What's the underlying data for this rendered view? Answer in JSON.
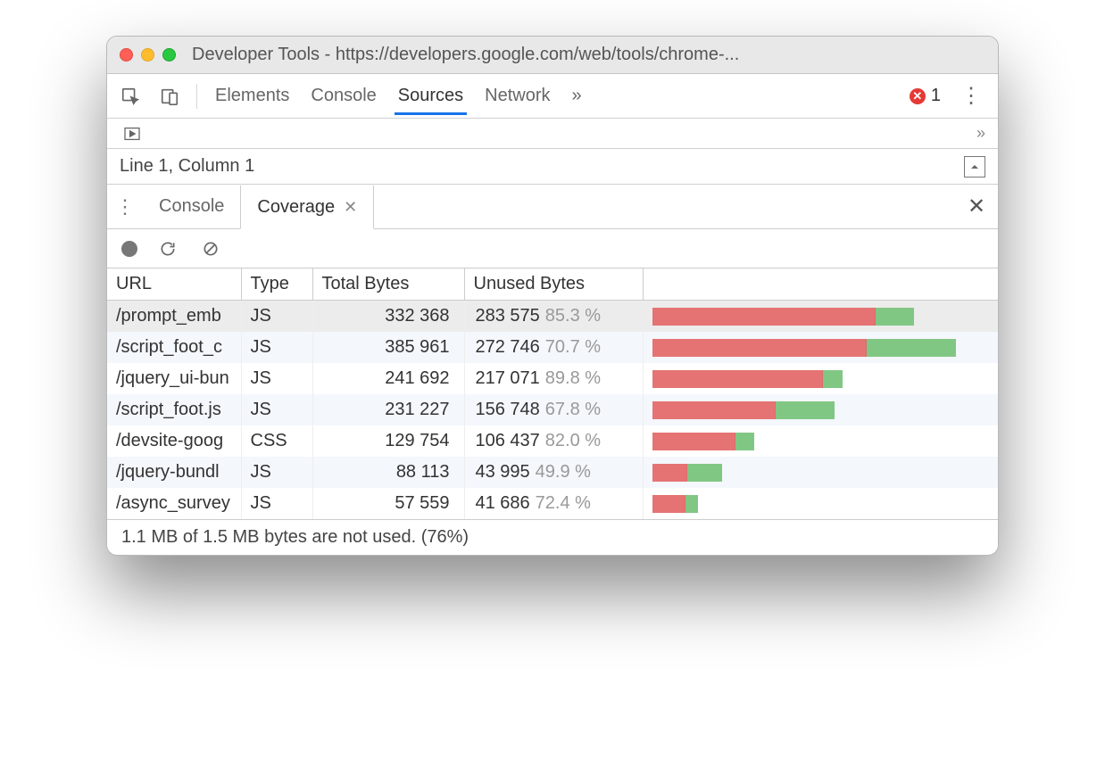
{
  "window": {
    "title": "Developer Tools - https://developers.google.com/web/tools/chrome-..."
  },
  "toolbar": {
    "tabs": [
      "Elements",
      "Console",
      "Sources",
      "Network"
    ],
    "active_tab": "Sources",
    "overflow_glyph": "»",
    "error_count": "1"
  },
  "status": {
    "cursor_position": "Line 1, Column 1"
  },
  "drawer": {
    "tabs": [
      "Console",
      "Coverage"
    ],
    "active": "Coverage"
  },
  "coverage": {
    "headers": {
      "url": "URL",
      "type": "Type",
      "total": "Total Bytes",
      "unused": "Unused Bytes"
    },
    "max_total": 385961,
    "rows": [
      {
        "url": "/prompt_emb",
        "type": "JS",
        "total": "332 368",
        "unused": "283 575",
        "pct": "85.3 %",
        "total_n": 332368,
        "unused_pct": 85.3,
        "selected": true
      },
      {
        "url": "/script_foot_c",
        "type": "JS",
        "total": "385 961",
        "unused": "272 746",
        "pct": "70.7 %",
        "total_n": 385961,
        "unused_pct": 70.7
      },
      {
        "url": "/jquery_ui-bun",
        "type": "JS",
        "total": "241 692",
        "unused": "217 071",
        "pct": "89.8 %",
        "total_n": 241692,
        "unused_pct": 89.8
      },
      {
        "url": "/script_foot.js",
        "type": "JS",
        "total": "231 227",
        "unused": "156 748",
        "pct": "67.8 %",
        "total_n": 231227,
        "unused_pct": 67.8
      },
      {
        "url": "/devsite-goog",
        "type": "CSS",
        "total": "129 754",
        "unused": "106 437",
        "pct": "82.0 %",
        "total_n": 129754,
        "unused_pct": 82.0
      },
      {
        "url": "/jquery-bundl",
        "type": "JS",
        "total": "88 113",
        "unused": "43 995",
        "pct": "49.9 %",
        "total_n": 88113,
        "unused_pct": 49.9
      },
      {
        "url": "/async_survey",
        "type": "JS",
        "total": "57 559",
        "unused": "41 686",
        "pct": "72.4 %",
        "total_n": 57559,
        "unused_pct": 72.4
      }
    ],
    "footer": "1.1 MB of 1.5 MB bytes are not used. (76%)"
  }
}
